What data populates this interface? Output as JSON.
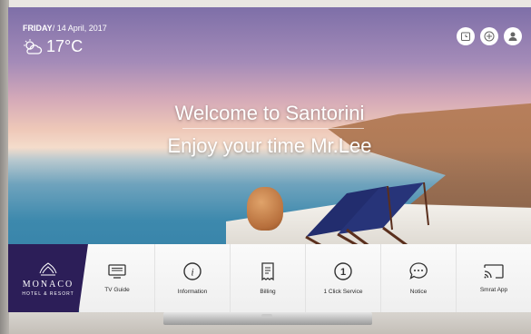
{
  "header": {
    "day": "FRIDAY",
    "date": "/ 14 April, 2017",
    "temperature": "17°C"
  },
  "top_icons": [
    "clock-icon",
    "plus-circle-icon",
    "user-icon"
  ],
  "hero": {
    "welcome": "Welcome to Santorini",
    "greeting": "Enjoy your time Mr.Lee"
  },
  "brand": {
    "name": "MONACO",
    "tagline": "HOTEL & RESORT"
  },
  "menu": [
    {
      "label": "TV Guide",
      "icon": "tv-guide-icon"
    },
    {
      "label": "Information",
      "icon": "info-icon"
    },
    {
      "label": "Billing",
      "icon": "billing-icon"
    },
    {
      "label": "1 Click Service",
      "icon": "one-click-icon"
    },
    {
      "label": "Notice",
      "icon": "notice-icon"
    },
    {
      "label": "Smrat App",
      "icon": "cast-icon"
    }
  ]
}
